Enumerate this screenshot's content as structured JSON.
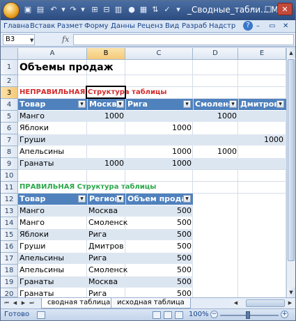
{
  "window": {
    "title": "_Сводные_табли...",
    "app_suffix": "M",
    "minimize_glyph": "–",
    "maximize_glyph": "□",
    "close_glyph": "✕"
  },
  "ribbon": {
    "tabs": [
      "Главна",
      "Вставк",
      "Размет",
      "Форму",
      "Данны",
      "Реценз",
      "Вид",
      "Разраб",
      "Надстр"
    ],
    "help_glyph": "?"
  },
  "formula_bar": {
    "name_box": "B3",
    "fx": "fx",
    "content": ""
  },
  "sheet": {
    "columns": [
      "A",
      "B",
      "C",
      "D",
      "E"
    ],
    "selected_column": "B",
    "rows": [
      "1",
      "2",
      "3",
      "4",
      "5",
      "6",
      "7",
      "8",
      "9",
      "10",
      "11",
      "12",
      "13",
      "14",
      "15",
      "16",
      "17",
      "18",
      "19",
      "20"
    ],
    "selected_row": "3",
    "title": "Объемы продаж",
    "wrong_label": "НЕПРАВИЛЬНАЯ Структура таблицы",
    "wrong_table": {
      "headers": [
        "Товар",
        "Москва",
        "Рига",
        "Смоленс",
        "Дмитров"
      ],
      "rows": [
        [
          "Манго",
          "1000",
          "",
          "1000",
          ""
        ],
        [
          "Яблоки",
          "",
          "1000",
          "",
          ""
        ],
        [
          "Груши",
          "",
          "",
          "",
          "1000"
        ],
        [
          "Апельсины",
          "",
          "1000",
          "1000",
          ""
        ],
        [
          "Гранаты",
          "1000",
          "1000",
          "",
          ""
        ]
      ]
    },
    "right_label": "ПРАВИЛЬНАЯ Структура таблицы",
    "right_table": {
      "headers": [
        "Товар",
        "Регион",
        "Объем продаж"
      ],
      "rows": [
        [
          "Манго",
          "Москва",
          "500"
        ],
        [
          "Манго",
          "Смоленск",
          "500"
        ],
        [
          "Яблоки",
          "Рига",
          "500"
        ],
        [
          "Груши",
          "Дмитров",
          "500"
        ],
        [
          "Апельсины",
          "Рига",
          "500"
        ],
        [
          "Апельсины",
          "Смоленск",
          "500"
        ],
        [
          "Гранаты",
          "Москва",
          "500"
        ],
        [
          "Гранаты",
          "Рига",
          "500"
        ]
      ]
    }
  },
  "sheet_tabs": [
    "сводная таблица",
    "исходная таблица"
  ],
  "status": {
    "ready": "Готово",
    "zoom": "100%"
  }
}
